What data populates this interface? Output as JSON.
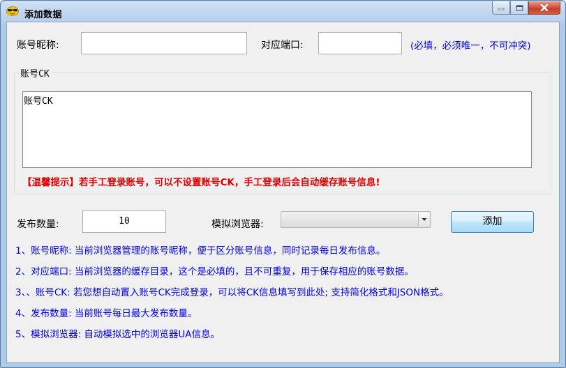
{
  "window": {
    "title": "添加数据"
  },
  "form": {
    "nickname_label": "账号昵称:",
    "nickname_value": "",
    "port_label": "对应端口:",
    "port_value": "",
    "port_hint": "(必填，必须唯一，不可冲突)",
    "ck_group_title": "账号CK",
    "ck_value": "账号CK",
    "warning": "【温馨提示】若手工登录账号，可以不设置账号CK，手工登录后会自动缓存账号信息!",
    "publish_count_label": "发布数量:",
    "publish_count_value": "10",
    "browser_label": "模拟浏览器:",
    "browser_value": "",
    "add_button": "添加"
  },
  "notes": [
    "1、账号昵称: 当前浏览器管理的账号昵称，便于区分账号信息，同时记录每日发布信息。",
    "2、对应端口: 当前浏览器的缓存目录，这个是必填的，且不可重复，用于保存相应的账号数据。",
    "3、、账号CK: 若您想自动置入账号CK完成登录，可以将CK信息填写到此处; 支持简化格式和JSON格式。",
    "4、发布数量: 当前账号每日最大发布数量。",
    "5、模拟浏览器: 自动模拟选中的浏览器UA信息。"
  ],
  "colors": {
    "hint": "#0000ee",
    "warning": "#e00000",
    "titlebar": "#b9d1ee"
  },
  "icons": {
    "app": "sunglasses-face-icon",
    "minimize": "minimize-icon",
    "maximize": "maximize-icon",
    "close": "close-icon",
    "dropdown": "chevron-down-icon"
  }
}
